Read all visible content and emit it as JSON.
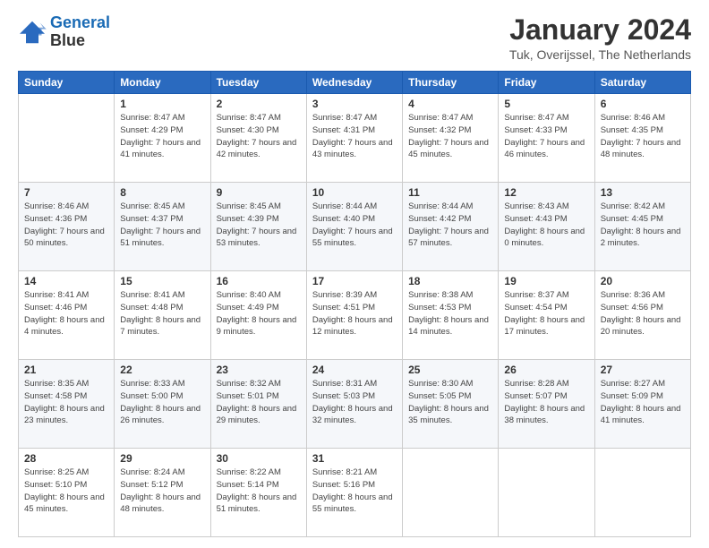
{
  "header": {
    "logo_line1": "General",
    "logo_line2": "Blue",
    "title": "January 2024",
    "subtitle": "Tuk, Overijssel, The Netherlands"
  },
  "calendar": {
    "days_of_week": [
      "Sunday",
      "Monday",
      "Tuesday",
      "Wednesday",
      "Thursday",
      "Friday",
      "Saturday"
    ],
    "weeks": [
      [
        {
          "num": "",
          "info": ""
        },
        {
          "num": "1",
          "info": "Sunrise: 8:47 AM\nSunset: 4:29 PM\nDaylight: 7 hours\nand 41 minutes."
        },
        {
          "num": "2",
          "info": "Sunrise: 8:47 AM\nSunset: 4:30 PM\nDaylight: 7 hours\nand 42 minutes."
        },
        {
          "num": "3",
          "info": "Sunrise: 8:47 AM\nSunset: 4:31 PM\nDaylight: 7 hours\nand 43 minutes."
        },
        {
          "num": "4",
          "info": "Sunrise: 8:47 AM\nSunset: 4:32 PM\nDaylight: 7 hours\nand 45 minutes."
        },
        {
          "num": "5",
          "info": "Sunrise: 8:47 AM\nSunset: 4:33 PM\nDaylight: 7 hours\nand 46 minutes."
        },
        {
          "num": "6",
          "info": "Sunrise: 8:46 AM\nSunset: 4:35 PM\nDaylight: 7 hours\nand 48 minutes."
        }
      ],
      [
        {
          "num": "7",
          "info": "Sunrise: 8:46 AM\nSunset: 4:36 PM\nDaylight: 7 hours\nand 50 minutes."
        },
        {
          "num": "8",
          "info": "Sunrise: 8:45 AM\nSunset: 4:37 PM\nDaylight: 7 hours\nand 51 minutes."
        },
        {
          "num": "9",
          "info": "Sunrise: 8:45 AM\nSunset: 4:39 PM\nDaylight: 7 hours\nand 53 minutes."
        },
        {
          "num": "10",
          "info": "Sunrise: 8:44 AM\nSunset: 4:40 PM\nDaylight: 7 hours\nand 55 minutes."
        },
        {
          "num": "11",
          "info": "Sunrise: 8:44 AM\nSunset: 4:42 PM\nDaylight: 7 hours\nand 57 minutes."
        },
        {
          "num": "12",
          "info": "Sunrise: 8:43 AM\nSunset: 4:43 PM\nDaylight: 8 hours\nand 0 minutes."
        },
        {
          "num": "13",
          "info": "Sunrise: 8:42 AM\nSunset: 4:45 PM\nDaylight: 8 hours\nand 2 minutes."
        }
      ],
      [
        {
          "num": "14",
          "info": "Sunrise: 8:41 AM\nSunset: 4:46 PM\nDaylight: 8 hours\nand 4 minutes."
        },
        {
          "num": "15",
          "info": "Sunrise: 8:41 AM\nSunset: 4:48 PM\nDaylight: 8 hours\nand 7 minutes."
        },
        {
          "num": "16",
          "info": "Sunrise: 8:40 AM\nSunset: 4:49 PM\nDaylight: 8 hours\nand 9 minutes."
        },
        {
          "num": "17",
          "info": "Sunrise: 8:39 AM\nSunset: 4:51 PM\nDaylight: 8 hours\nand 12 minutes."
        },
        {
          "num": "18",
          "info": "Sunrise: 8:38 AM\nSunset: 4:53 PM\nDaylight: 8 hours\nand 14 minutes."
        },
        {
          "num": "19",
          "info": "Sunrise: 8:37 AM\nSunset: 4:54 PM\nDaylight: 8 hours\nand 17 minutes."
        },
        {
          "num": "20",
          "info": "Sunrise: 8:36 AM\nSunset: 4:56 PM\nDaylight: 8 hours\nand 20 minutes."
        }
      ],
      [
        {
          "num": "21",
          "info": "Sunrise: 8:35 AM\nSunset: 4:58 PM\nDaylight: 8 hours\nand 23 minutes."
        },
        {
          "num": "22",
          "info": "Sunrise: 8:33 AM\nSunset: 5:00 PM\nDaylight: 8 hours\nand 26 minutes."
        },
        {
          "num": "23",
          "info": "Sunrise: 8:32 AM\nSunset: 5:01 PM\nDaylight: 8 hours\nand 29 minutes."
        },
        {
          "num": "24",
          "info": "Sunrise: 8:31 AM\nSunset: 5:03 PM\nDaylight: 8 hours\nand 32 minutes."
        },
        {
          "num": "25",
          "info": "Sunrise: 8:30 AM\nSunset: 5:05 PM\nDaylight: 8 hours\nand 35 minutes."
        },
        {
          "num": "26",
          "info": "Sunrise: 8:28 AM\nSunset: 5:07 PM\nDaylight: 8 hours\nand 38 minutes."
        },
        {
          "num": "27",
          "info": "Sunrise: 8:27 AM\nSunset: 5:09 PM\nDaylight: 8 hours\nand 41 minutes."
        }
      ],
      [
        {
          "num": "28",
          "info": "Sunrise: 8:25 AM\nSunset: 5:10 PM\nDaylight: 8 hours\nand 45 minutes."
        },
        {
          "num": "29",
          "info": "Sunrise: 8:24 AM\nSunset: 5:12 PM\nDaylight: 8 hours\nand 48 minutes."
        },
        {
          "num": "30",
          "info": "Sunrise: 8:22 AM\nSunset: 5:14 PM\nDaylight: 8 hours\nand 51 minutes."
        },
        {
          "num": "31",
          "info": "Sunrise: 8:21 AM\nSunset: 5:16 PM\nDaylight: 8 hours\nand 55 minutes."
        },
        {
          "num": "",
          "info": ""
        },
        {
          "num": "",
          "info": ""
        },
        {
          "num": "",
          "info": ""
        }
      ]
    ]
  }
}
